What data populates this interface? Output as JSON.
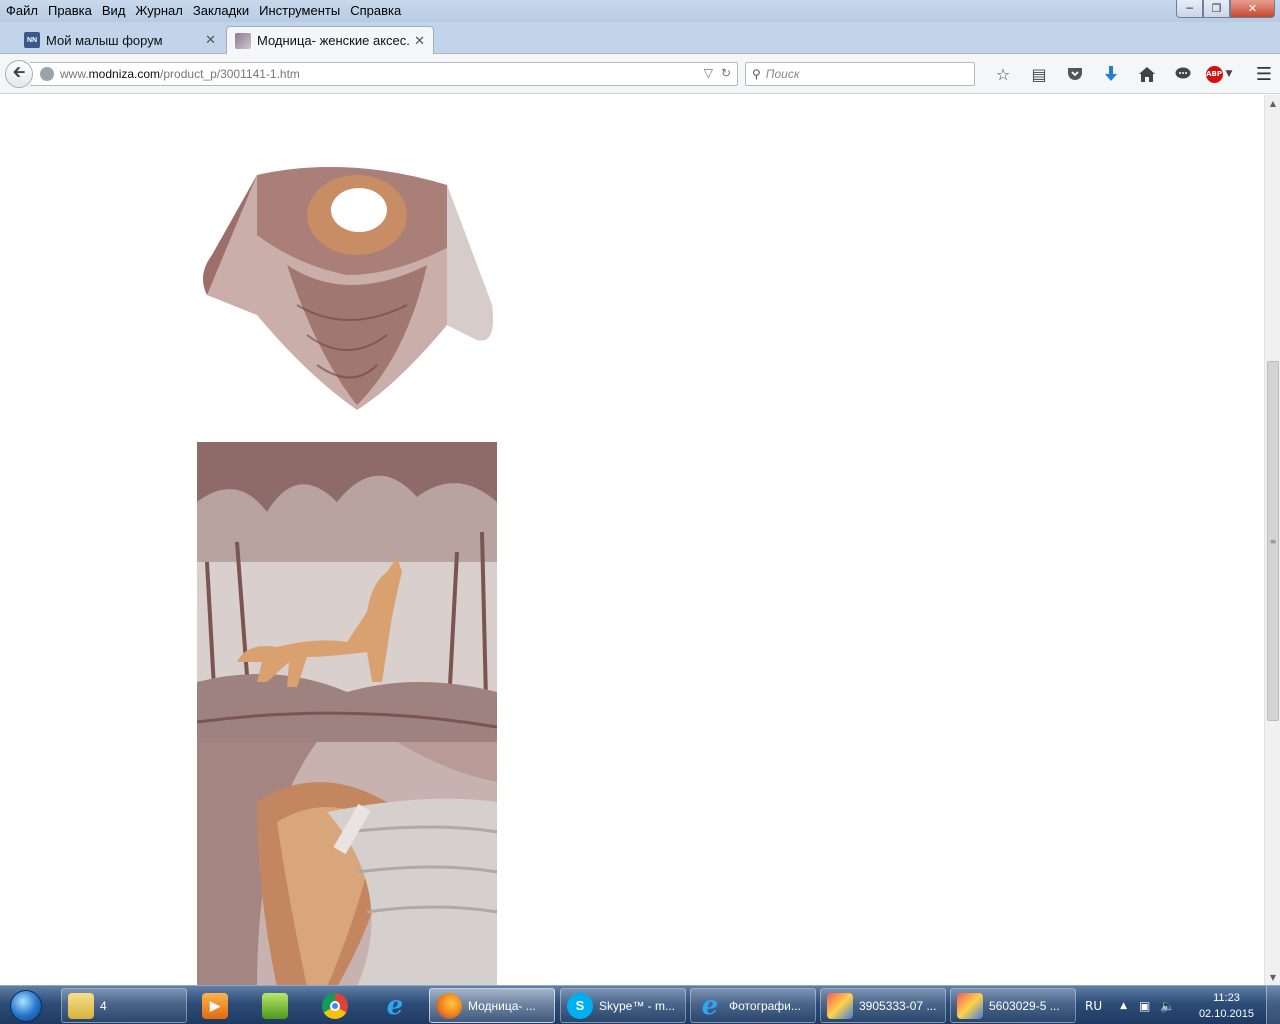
{
  "menu": [
    "Файл",
    "Правка",
    "Вид",
    "Журнал",
    "Закладки",
    "Инструменты",
    "Справка"
  ],
  "tabs": [
    {
      "favicon": "NN",
      "title": "Мой малыш форум",
      "active": false
    },
    {
      "favicon": "",
      "title": "Модница- женские аксес...",
      "active": true
    }
  ],
  "url": {
    "prefix": "www.",
    "domain": "modniza.com",
    "path": "/product_p/3001141-1.htm"
  },
  "search": {
    "placeholder": "Поиск"
  },
  "toolbar_icons": [
    "star-icon",
    "reading-list-icon",
    "pocket-icon",
    "download-icon",
    "home-icon",
    "chat-icon",
    "adblock-icon"
  ],
  "adblock": {
    "label": "ABP"
  },
  "taskbar": {
    "items": [
      {
        "label": "4",
        "icon": "folder-icon"
      },
      {
        "label": "",
        "icon": "media-player-icon"
      },
      {
        "label": "",
        "icon": "network-app-icon"
      },
      {
        "label": "",
        "icon": "chrome-icon"
      },
      {
        "label": "",
        "icon": "ie-icon"
      },
      {
        "label": "Модница- ...",
        "icon": "firefox-icon"
      },
      {
        "label": "Skype™ - m...",
        "icon": "skype-icon"
      },
      {
        "label": "Фотографи...",
        "icon": "ie-icon"
      },
      {
        "label": "3905333-07 ...",
        "icon": "image-viewer-icon"
      },
      {
        "label": "5603029-5 ...",
        "icon": "image-viewer-icon"
      }
    ],
    "language": "RU",
    "time": "11:23",
    "date": "02.10.2015"
  }
}
